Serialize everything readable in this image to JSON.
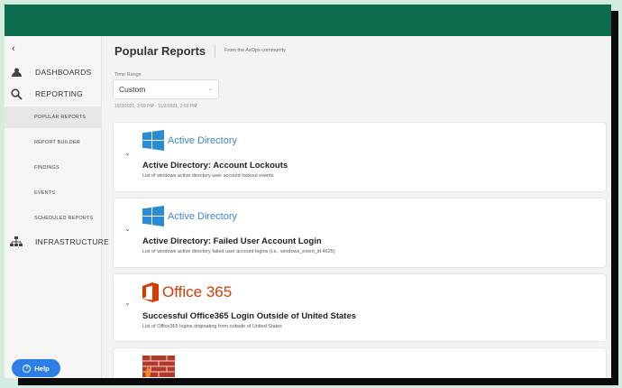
{
  "sidebar": {
    "collapse_icon": "chevron-left-icon",
    "items": [
      {
        "label": "DASHBOARDS",
        "icon": "dashboard-icon"
      },
      {
        "label": "REPORTING",
        "icon": "search-icon"
      }
    ],
    "sub_items": [
      {
        "label": "POPULAR REPORTS",
        "active": true
      },
      {
        "label": "REPORT BUILDER"
      },
      {
        "label": "FINDINGS"
      },
      {
        "label": "EVENTS"
      },
      {
        "label": "SCHEDULED REPORTS"
      }
    ],
    "infra": {
      "label": "INFRASTRUCTURE",
      "icon": "hierarchy-icon"
    },
    "help_label": "Help"
  },
  "main": {
    "title": "Popular Reports",
    "subtitle": "From the AxOps community",
    "time_range": {
      "label": "Time Range",
      "value": "Custom",
      "range_text": "10/3/2021, 3:59 PM - 11/2/2021, 3:59 PM"
    },
    "cards": [
      {
        "logo_text": "Active Directory",
        "logo": "windows-logo",
        "title": "Active Directory: Account Lockouts",
        "description": "List of windows active directory user account lockout events"
      },
      {
        "logo_text": "Active Directory",
        "logo": "windows-logo",
        "title": "Active Directory: Failed User Account Login",
        "description": "List of windows active directory failed user account logins (i.e., windows_event_id 4625)"
      },
      {
        "logo_text": "Office 365",
        "logo": "office365-logo",
        "title": "Successful Office365 Login Outside of United States",
        "description": "List of Office365 logins originating from outside of United States"
      },
      {
        "logo": "firewall-logo"
      }
    ]
  },
  "colors": {
    "topbar": "#0d6b4e",
    "accent_blue": "#2d7fe6",
    "ad_blue": "#3d86c6",
    "office_orange": "#d83b01"
  }
}
